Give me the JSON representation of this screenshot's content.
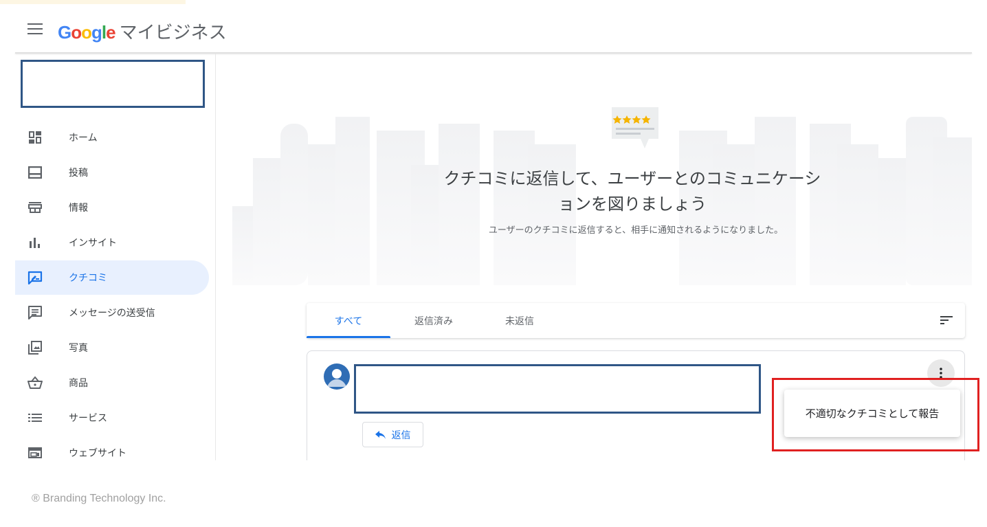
{
  "header": {
    "logo_text": "Google",
    "product_name": "マイビジネス"
  },
  "sidebar": {
    "items": [
      {
        "label": "ホーム",
        "icon": "dashboard-icon"
      },
      {
        "label": "投稿",
        "icon": "post-icon"
      },
      {
        "label": "情報",
        "icon": "store-icon"
      },
      {
        "label": "インサイト",
        "icon": "bar-chart-icon"
      },
      {
        "label": "クチコミ",
        "icon": "rate-review-icon",
        "active": true
      },
      {
        "label": "メッセージの送受信",
        "icon": "message-icon"
      },
      {
        "label": "写真",
        "icon": "photo-library-icon"
      },
      {
        "label": "商品",
        "icon": "shopping-basket-icon"
      },
      {
        "label": "サービス",
        "icon": "list-icon"
      },
      {
        "label": "ウェブサイト",
        "icon": "web-icon"
      }
    ]
  },
  "hero": {
    "title": "クチコミに返信して、ユーザーとのコミュニケーションを図りましょう",
    "subtitle": "ユーザーのクチコミに返信すると、相手に通知されるようになりました。"
  },
  "tabs": [
    {
      "label": "すべて",
      "active": true
    },
    {
      "label": "返信済み",
      "active": false
    },
    {
      "label": "未返信",
      "active": false
    }
  ],
  "review": {
    "reply_label": "返信"
  },
  "menu": {
    "report_label": "不適切なクチコミとして報告"
  },
  "footer": {
    "copyright": "® Branding Technology Inc."
  },
  "colors": {
    "accent": "#1a73e8",
    "active_nav_bg": "#e8f0fe",
    "highlight_red": "#e02020",
    "redaction_blue": "#2f5686"
  }
}
